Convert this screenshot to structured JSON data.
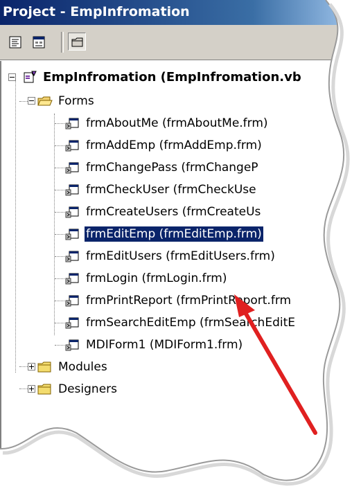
{
  "window": {
    "title": "Project - EmpInfromation"
  },
  "toolbar": {
    "buttons": [
      {
        "name": "view-code-icon"
      },
      {
        "name": "view-object-icon"
      },
      {
        "name": "toggle-folders-icon"
      }
    ]
  },
  "tree": {
    "root": {
      "label": "EmpInfromation (EmpInfromation.vb"
    },
    "forms_folder": {
      "label": "Forms"
    },
    "forms": [
      {
        "label": "frmAboutMe (frmAboutMe.frm)"
      },
      {
        "label": "frmAddEmp (frmAddEmp.frm)"
      },
      {
        "label": "frmChangePass (frmChangeP"
      },
      {
        "label": "frmCheckUser (frmCheckUse"
      },
      {
        "label": "frmCreateUsers (frmCreateUs"
      },
      {
        "label": "frmEditEmp (frmEditEmp.frm)",
        "selected": true
      },
      {
        "label": "frmEditUsers (frmEditUsers.frm)"
      },
      {
        "label": "frmLogin (frmLogin.frm)"
      },
      {
        "label": "frmPrintReport (frmPrintReport.frm"
      },
      {
        "label": "frmSearchEditEmp (frmSearchEditE"
      },
      {
        "label": "MDIForm1 (MDIForm1.frm)"
      }
    ],
    "modules_folder": {
      "label": "Modules"
    },
    "designers_folder": {
      "label": "Designers"
    }
  },
  "colors": {
    "selection": "#0a246a",
    "arrow": "#e02020",
    "titlebar": "#0a246a"
  }
}
